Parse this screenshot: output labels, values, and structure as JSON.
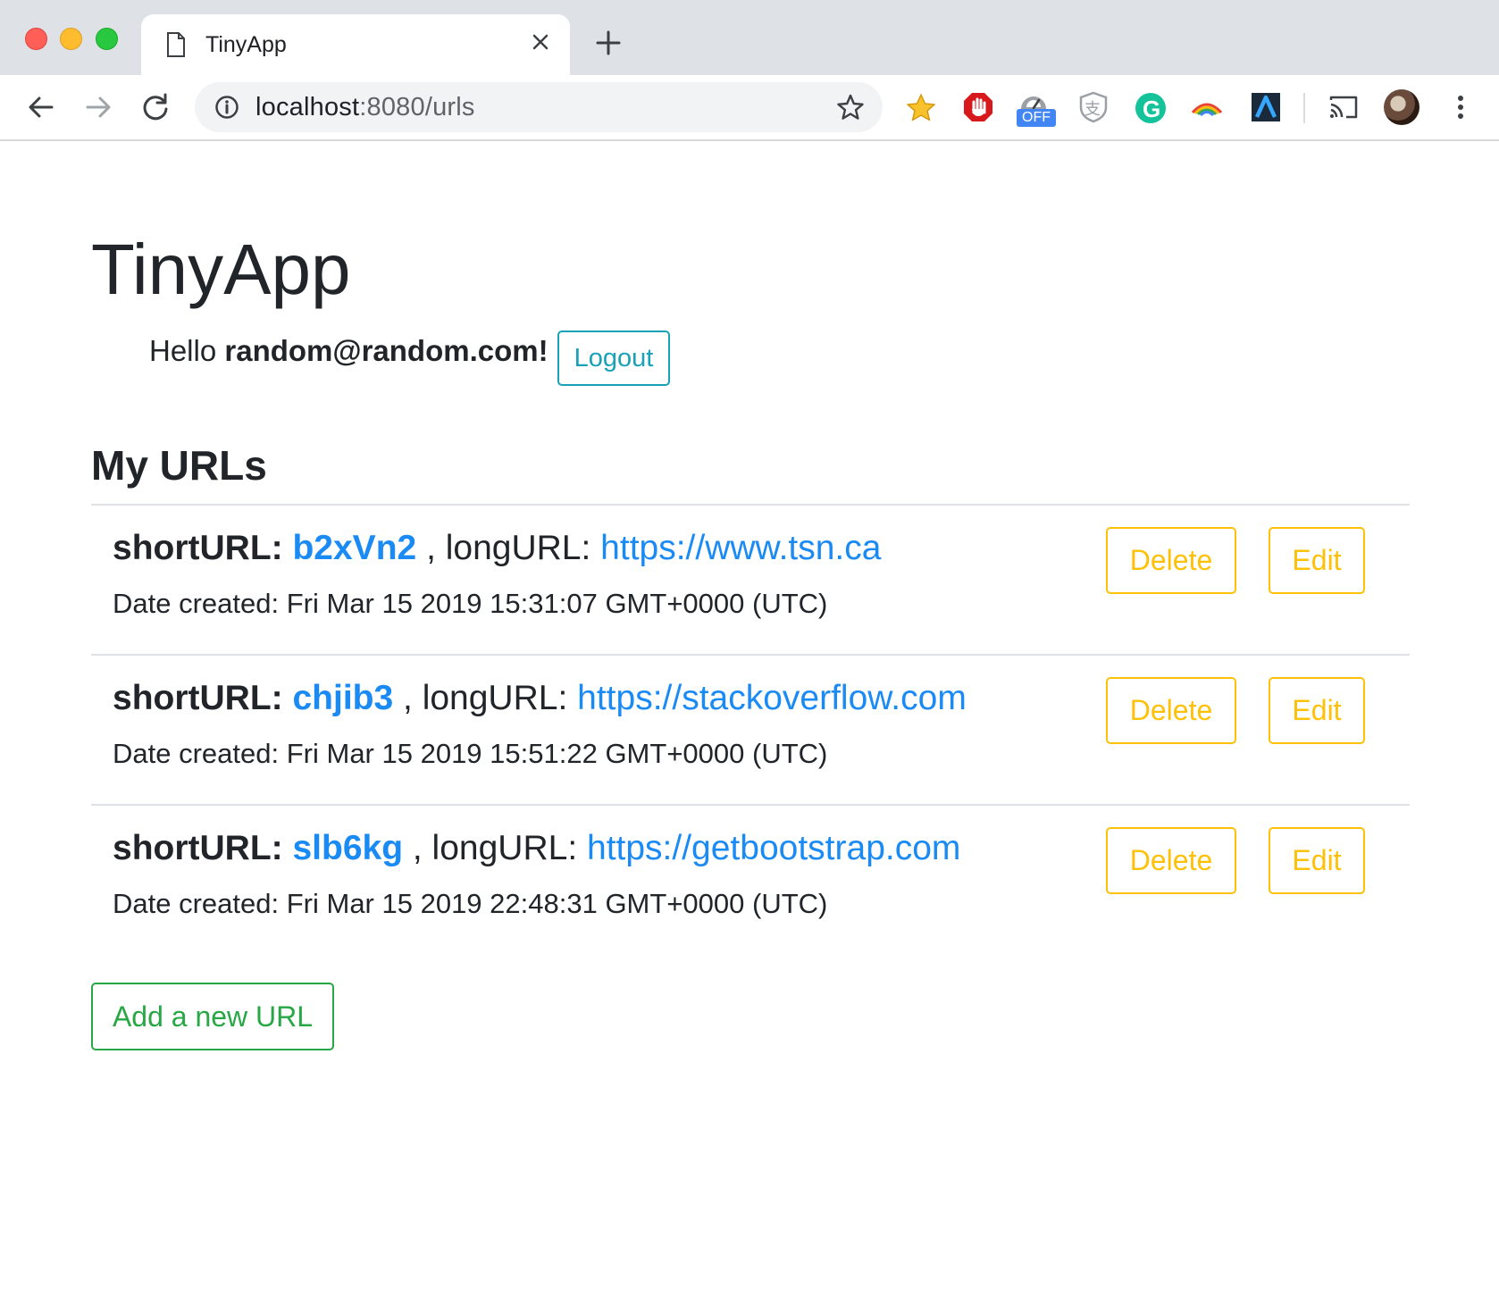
{
  "browser": {
    "tab": {
      "title": "TinyApp",
      "icon": "document-icon"
    },
    "address": {
      "host": "localhost",
      "rest": ":8080/urls"
    },
    "extensions": [
      "star-extension-icon",
      "adblock-icon",
      "off-badge-icon",
      "shield-icon",
      "grammarly-icon",
      "rainbow-icon",
      "a-logo-icon",
      "cast-icon",
      "profile-avatar"
    ],
    "ext_badge": "OFF",
    "ext_shield_char": "支",
    "grammarly_char": "G"
  },
  "page": {
    "title": "TinyApp",
    "greeting_prefix": "Hello",
    "user_email": "random@random.com!",
    "logout_label": "Logout",
    "section_title": "My URLs",
    "short_label": "shortURL:",
    "long_label": ", longURL:",
    "date_label": "Date created:",
    "delete_label": "Delete",
    "edit_label": "Edit",
    "add_label": "Add a new URL",
    "urls": [
      {
        "short": "b2xVn2",
        "long": "https://www.tsn.ca",
        "date": "Fri Mar 15 2019 15:31:07 GMT+0000 (UTC)"
      },
      {
        "short": "chjib3",
        "long": "https://stackoverflow.com",
        "date": "Fri Mar 15 2019 15:51:22 GMT+0000 (UTC)"
      },
      {
        "short": "slb6kg",
        "long": "https://getbootstrap.com",
        "date": "Fri Mar 15 2019 22:48:31 GMT+0000 (UTC)"
      }
    ]
  },
  "colors": {
    "link": "#1a8af4",
    "warning": "#ffc107",
    "info": "#17a2b8",
    "success": "#28a745"
  }
}
